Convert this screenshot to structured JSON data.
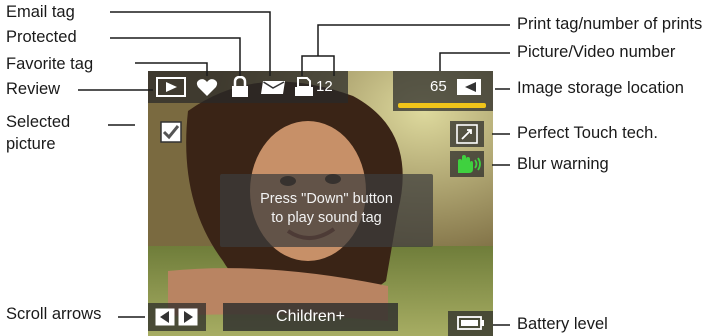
{
  "callouts": {
    "email_tag": "Email tag",
    "protected": "Protected",
    "favorite_tag": "Favorite tag",
    "review": "Review",
    "selected_picture_line1": "Selected",
    "selected_picture_line2": "picture",
    "scroll_arrows": "Scroll arrows",
    "print_tag": "Print tag/number of prints",
    "picture_video_number": "Picture/Video number",
    "image_storage_location": "Image storage location",
    "perfect_touch": "Perfect Touch tech.",
    "blur_warning": "Blur warning",
    "battery_level": "Battery level"
  },
  "screen": {
    "print_count": "12",
    "picture_number": "65",
    "message_line1": "Press \"Down\" button",
    "message_line2": "to play sound tag",
    "album_name": "Children+"
  },
  "colors": {
    "accent_yellow": "#f0c419",
    "blur_green": "#3fd13f",
    "callout_line": "#1a1a1a"
  },
  "icons": [
    "review-icon",
    "heart-icon",
    "lock-icon",
    "envelope-icon",
    "print-icon",
    "storage-icon",
    "check-icon",
    "perfect-touch-icon",
    "shaking-hand-icon",
    "scroll-left-icon",
    "scroll-right-icon",
    "battery-icon"
  ]
}
